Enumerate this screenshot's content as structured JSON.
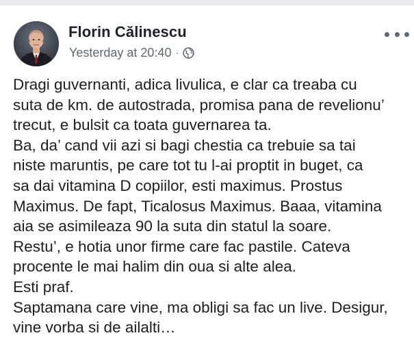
{
  "post": {
    "author": "Florin Călinescu",
    "timestamp": "Yesterday at 20:40",
    "separator": "·",
    "privacy_icon": "globe-icon",
    "more_icon": "more-options-icon",
    "lines": [
      "Dragi guvernanti, adica livulica, e clar ca treaba cu",
      "suta de km. de autostrada, promisa pana de revelionu’",
      "trecut, e bulsit ca toata guvernarea ta.",
      "Ba, da’ cand vii azi si bagi chestia ca trebuie sa tai",
      "niste maruntis, pe care tot tu l-ai proptit in buget, ca",
      "sa dai vitamina D copiilor, esti maximus. Prostus",
      "Maximus. De fapt, Ticalosus Maximus. Baaa, vitamina",
      "aia se asimileaza 90 la suta din statul la soare.",
      "Restu’, e hotia unor firme care fac pastile. Cateva",
      "procente le mai halim din oua si alte alea.",
      "Esti praf.",
      "Saptamana care vine, ma obligi sa fac un live. Desigur,",
      "vine vorba si de ailalti…"
    ]
  },
  "colors": {
    "background": "#ffffff",
    "top_strip": "#e9ebee",
    "author_text": "#1d2129",
    "meta_text": "#606770",
    "body_text": "#1c1e21"
  }
}
